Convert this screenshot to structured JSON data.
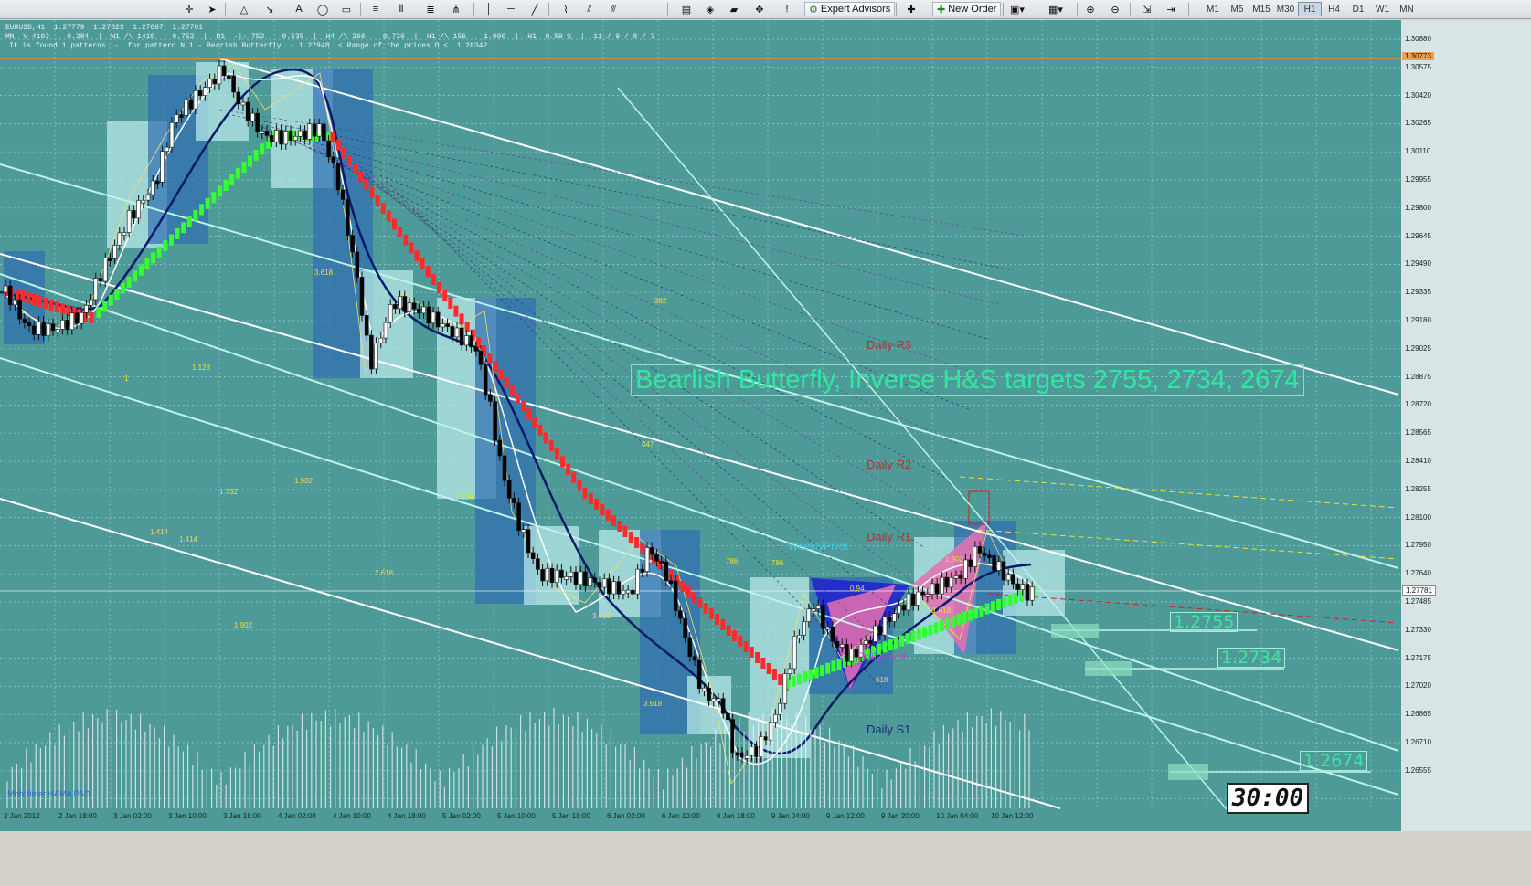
{
  "toolbar": {
    "expert_advisors": "Expert Advisors",
    "new_order": "New Order",
    "timeframes": [
      "M1",
      "M5",
      "M15",
      "M30",
      "H1",
      "H4",
      "D1",
      "W1",
      "MN"
    ],
    "active_timeframe": "H1"
  },
  "chart": {
    "symbol_line": "EURUSD,H1  1.27779  1.27823  1.27667  1.27781",
    "info_line1": "MN  V 4103    0.284  |  W1 /\\ 1410    0.752  |  D1  -|- 752    0.535  |  H4 /\\ 266    0.726  |  H1 /\\ 156    1.000  |  H1  0.59 %  |  11 / 9 / 8 / 3",
    "info_line2": "It is found 1 patterns  -  for pattern N 1 - Bearish Butterfly  - 1.27948  < Range of the prices D <  1.28342",
    "headline": "Bearlish Butterfly, Inverse H&S targets 2755, 2734, 2674",
    "pivots": {
      "r3": "Daily R3",
      "r2": "Daily R2",
      "r1": "Daily R1",
      "weekly": "WeeklyPivot",
      "daily": "DailyPivot",
      "s1": "Daily S1"
    },
    "targets": [
      "1.2755",
      "1.2734",
      "1.2674"
    ],
    "indicator_label": "Mbfx timer HAMA PAD",
    "timer": "30:00",
    "bid_price": "1.27781",
    "top_price": "1.30773",
    "price_ticks": [
      "1.30880",
      "1.30575",
      "1.30420",
      "1.30265",
      "1.30110",
      "1.29955",
      "1.29800",
      "1.29645",
      "1.29490",
      "1.29335",
      "1.29180",
      "1.29025",
      "1.28875",
      "1.28720",
      "1.28565",
      "1.28410",
      "1.28255",
      "1.28100",
      "1.27950",
      "1.27640",
      "1.27485",
      "1.27330",
      "1.27175",
      "1.27020",
      "1.26865",
      "1.26710",
      "1.26555"
    ],
    "time_ticks": [
      "2 Jan 2012",
      "2 Jan 18:00",
      "3 Jan 02:00",
      "3 Jan 10:00",
      "3 Jan 18:00",
      "4 Jan 02:00",
      "4 Jan 10:00",
      "4 Jan 18:00",
      "5 Jan 02:00",
      "5 Jan 10:00",
      "5 Jan 18:00",
      "6 Jan 02:00",
      "6 Jan 10:00",
      "6 Jan 18:00",
      "9 Jan 04:00",
      "9 Jan 12:00",
      "9 Jan 20:00",
      "10 Jan 04:00",
      "10 Jan 12:00"
    ],
    "fib_labels": [
      "3.618",
      "1.128",
      "1",
      "1.902",
      "1.732",
      "1.414",
      "1.414",
      "2.618",
      "1.902",
      "382",
      "447",
      "3.618",
      "786",
      "786",
      "0.94",
      "1.902",
      "618",
      "3.618",
      "1.128",
      "1.618"
    ],
    "colors": {
      "background": "#4e9a98",
      "grid": "#9fcaca",
      "bull_candle": "#ffffff",
      "bear_candle": "#000000",
      "trend_up": "#33ff33",
      "trend_down": "#ff2222",
      "headline": "#2ee8a0",
      "pivot_resistance": "#b33030",
      "pivot_support": "#1a2a7a"
    }
  }
}
